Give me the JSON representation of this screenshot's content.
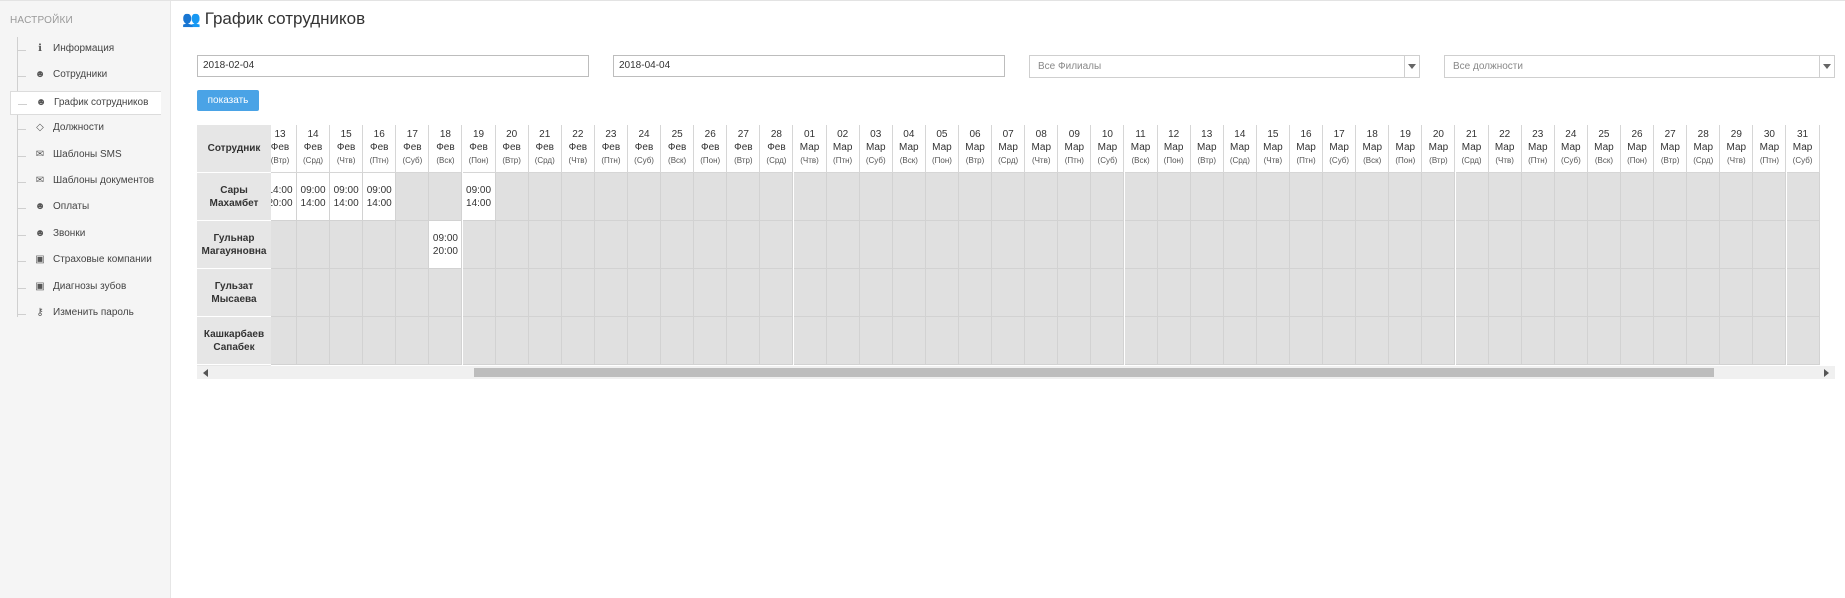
{
  "sidebar": {
    "title": "НАСТРОЙКИ",
    "items": [
      {
        "label": "Информация",
        "icon": "info-icon"
      },
      {
        "label": "Сотрудники",
        "icon": "users-icon"
      },
      {
        "label": "График сотрудников",
        "icon": "users-icon",
        "active": true
      },
      {
        "label": "Должности",
        "icon": "diamond-icon"
      },
      {
        "label": "Шаблоны SMS",
        "icon": "envelope-icon"
      },
      {
        "label": "Шаблоны документов",
        "icon": "envelope-icon"
      },
      {
        "label": "Оплаты",
        "icon": "users-icon"
      },
      {
        "label": "Звонки",
        "icon": "users-icon"
      },
      {
        "label": "Страховые компании",
        "icon": "briefcase-icon"
      },
      {
        "label": "Диагнозы зубов",
        "icon": "briefcase-icon"
      },
      {
        "label": "Изменить пароль",
        "icon": "key-icon"
      }
    ]
  },
  "header": {
    "title": "График сотрудников"
  },
  "filters": {
    "date_from": "2018-02-04",
    "date_to": "2018-04-04",
    "branch_select": "Все Филиалы",
    "position_select": "Все должности",
    "show_button": "показать"
  },
  "schedule": {
    "employee_header": "Сотрудник",
    "first_day_partial": {
      "day": "13",
      "month": "Фев",
      "weekday": "(Втр)"
    },
    "days": [
      {
        "day": "14",
        "month": "Фев",
        "weekday": "(Срд)"
      },
      {
        "day": "15",
        "month": "Фев",
        "weekday": "(Чтв)"
      },
      {
        "day": "16",
        "month": "Фев",
        "weekday": "(Птн)"
      },
      {
        "day": "17",
        "month": "Фев",
        "weekday": "(Суб)"
      },
      {
        "day": "18",
        "month": "Фев",
        "weekday": "(Вск)"
      },
      {
        "day": "19",
        "month": "Фев",
        "weekday": "(Пон)"
      },
      {
        "day": "20",
        "month": "Фев",
        "weekday": "(Втр)"
      },
      {
        "day": "21",
        "month": "Фев",
        "weekday": "(Срд)"
      },
      {
        "day": "22",
        "month": "Фев",
        "weekday": "(Чтв)"
      },
      {
        "day": "23",
        "month": "Фев",
        "weekday": "(Птн)"
      },
      {
        "day": "24",
        "month": "Фев",
        "weekday": "(Суб)"
      },
      {
        "day": "25",
        "month": "Фев",
        "weekday": "(Вск)"
      },
      {
        "day": "26",
        "month": "Фев",
        "weekday": "(Пон)"
      },
      {
        "day": "27",
        "month": "Фев",
        "weekday": "(Втр)"
      },
      {
        "day": "28",
        "month": "Фев",
        "weekday": "(Срд)"
      },
      {
        "day": "01",
        "month": "Мар",
        "weekday": "(Чтв)"
      },
      {
        "day": "02",
        "month": "Мар",
        "weekday": "(Птн)"
      },
      {
        "day": "03",
        "month": "Мар",
        "weekday": "(Суб)"
      },
      {
        "day": "04",
        "month": "Мар",
        "weekday": "(Вск)"
      },
      {
        "day": "05",
        "month": "Мар",
        "weekday": "(Пон)"
      },
      {
        "day": "06",
        "month": "Мар",
        "weekday": "(Втр)"
      },
      {
        "day": "07",
        "month": "Мар",
        "weekday": "(Срд)"
      },
      {
        "day": "08",
        "month": "Мар",
        "weekday": "(Чтв)"
      },
      {
        "day": "09",
        "month": "Мар",
        "weekday": "(Птн)"
      },
      {
        "day": "10",
        "month": "Мар",
        "weekday": "(Суб)"
      },
      {
        "day": "11",
        "month": "Мар",
        "weekday": "(Вск)"
      },
      {
        "day": "12",
        "month": "Мар",
        "weekday": "(Пон)"
      },
      {
        "day": "13",
        "month": "Мар",
        "weekday": "(Втр)"
      },
      {
        "day": "14",
        "month": "Мар",
        "weekday": "(Срд)"
      },
      {
        "day": "15",
        "month": "Мар",
        "weekday": "(Чтв)"
      },
      {
        "day": "16",
        "month": "Мар",
        "weekday": "(Птн)"
      },
      {
        "day": "17",
        "month": "Мар",
        "weekday": "(Суб)"
      },
      {
        "day": "18",
        "month": "Мар",
        "weekday": "(Вск)"
      },
      {
        "day": "19",
        "month": "Мар",
        "weekday": "(Пон)"
      },
      {
        "day": "20",
        "month": "Мар",
        "weekday": "(Втр)"
      },
      {
        "day": "21",
        "month": "Мар",
        "weekday": "(Срд)"
      },
      {
        "day": "22",
        "month": "Мар",
        "weekday": "(Чтв)"
      },
      {
        "day": "23",
        "month": "Мар",
        "weekday": "(Птн)"
      },
      {
        "day": "24",
        "month": "Мар",
        "weekday": "(Суб)"
      },
      {
        "day": "25",
        "month": "Мар",
        "weekday": "(Вск)"
      },
      {
        "day": "26",
        "month": "Мар",
        "weekday": "(Пон)"
      },
      {
        "day": "27",
        "month": "Мар",
        "weekday": "(Втр)"
      },
      {
        "day": "28",
        "month": "Мар",
        "weekday": "(Срд)"
      },
      {
        "day": "29",
        "month": "Мар",
        "weekday": "(Чтв)"
      },
      {
        "day": "30",
        "month": "Мар",
        "weekday": "(Птн)"
      },
      {
        "day": "31",
        "month": "Мар",
        "weekday": "(Суб)"
      }
    ],
    "employees": [
      {
        "name": "Сары Махамбет",
        "shifts": {
          "partial": [
            "14:00",
            "20:00"
          ],
          "0": [
            "09:00",
            "14:00"
          ],
          "1": [
            "09:00",
            "14:00"
          ],
          "2": [
            "09:00",
            "14:00"
          ],
          "5": [
            "09:00",
            "14:00"
          ]
        }
      },
      {
        "name": "Гульнар Магауяновна",
        "shifts": {
          "4": [
            "09:00",
            "20:00"
          ]
        }
      },
      {
        "name": "Гульзат Мысаева",
        "shifts": {}
      },
      {
        "name": "Кашкарбаев Сапабек",
        "shifts": {}
      }
    ]
  }
}
